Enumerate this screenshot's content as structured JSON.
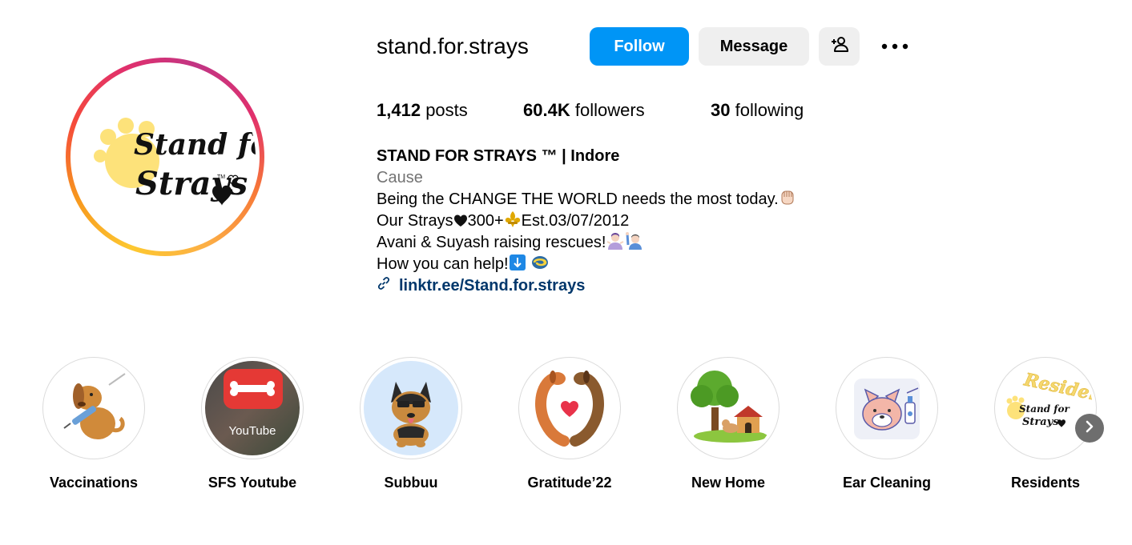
{
  "profile": {
    "username": "stand.for.strays",
    "avatar_text_line1": "Stand for",
    "avatar_text_line2": "Strays",
    "avatar_tm": "TM"
  },
  "actions": {
    "follow_label": "Follow",
    "message_label": "Message",
    "add_user_icon": "add-user-icon",
    "more_icon": "more-options-icon"
  },
  "stats": {
    "posts_count": "1,412",
    "posts_label": "posts",
    "followers_count": "60.4K",
    "followers_label": "followers",
    "following_count": "30",
    "following_label": "following"
  },
  "bio": {
    "name": "STAND FOR STRAYS ™ | Indore",
    "category": "Cause",
    "line1": "Being the CHANGE THE WORLD needs the most today.",
    "line2_a": "Our Strays",
    "line2_b": "300+",
    "line2_c": "Est.03/07/2012",
    "line3": "Avani & Suyash raising rescues!",
    "line4": "How you can help!",
    "link": "linktr.ee/Stand.for.strays"
  },
  "highlights": [
    {
      "label": "Vaccinations"
    },
    {
      "label": "SFS Youtube",
      "badge_text": "YouTube"
    },
    {
      "label": "Subbuu"
    },
    {
      "label": "Gratitude’22"
    },
    {
      "label": "New Home"
    },
    {
      "label": "Ear Cleaning"
    },
    {
      "label": "Residents",
      "img_text1": "Residents",
      "img_text2": "Stand for",
      "img_text3": "Strays"
    }
  ],
  "colors": {
    "follow_blue": "#0095f6",
    "link_blue": "#00376b",
    "secondary_gray": "#737373",
    "button_gray": "#efefef"
  }
}
